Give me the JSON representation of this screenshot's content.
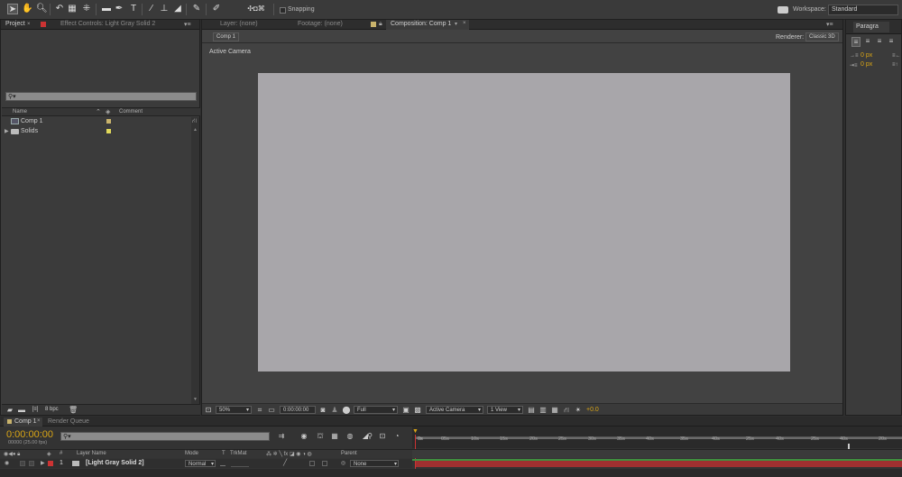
{
  "toolbar": {
    "snapping_label": "Snapping",
    "workspace_label": "Workspace:",
    "workspace_value": "Standard"
  },
  "project_panel": {
    "tab_project": "Project",
    "tab_effect_controls": "Effect Controls: Light Gray Solid 2",
    "search_placeholder": "",
    "col_name": "Name",
    "col_comment": "Comment",
    "items": [
      {
        "name": "Comp 1",
        "label_color": "#c9b36c"
      },
      {
        "name": "Solids",
        "label_color": "#e0d85a"
      }
    ],
    "bpc_label": "8 bpc"
  },
  "viewer": {
    "tab_layer": "Layer: (none)",
    "tab_footage": "Footage: (none)",
    "tab_composition": "Composition: Comp 1",
    "comp_button": "Comp 1",
    "renderer_label": "Renderer:",
    "renderer_value": "Classic 3D",
    "active_camera_label": "Active Camera",
    "canvas_color": "#a8a6aa",
    "footer": {
      "zoom": "50%",
      "timecode": "0:00:00:00",
      "resolution": "Full",
      "camera": "Active Camera",
      "views": "1 View",
      "exposure": "+0.0"
    }
  },
  "paragraph_panel": {
    "tab": "Paragra",
    "indent_values": [
      "0 px",
      "0 px",
      "0 px"
    ]
  },
  "timeline": {
    "tab_comp": "Comp 1",
    "tab_render_queue": "Render Queue",
    "timecode": "0:00:00:00",
    "frame_info": "00000 (25.00 fps)",
    "col_layer_name": "Layer Name",
    "col_mode": "Mode",
    "col_t": "T",
    "col_trkmat": "TrkMat",
    "col_parent": "Parent",
    "col_hash": "#",
    "ruler_ticks": [
      "0s",
      "05s",
      "10s",
      "15s",
      "20s",
      "25s",
      "30s",
      "35s",
      "40s",
      "45s",
      "50s",
      "55s",
      "01:00s",
      "05s",
      "10s",
      "15s",
      "20s"
    ],
    "ruler_ticks_visible": [
      "0s",
      "05s",
      "10s",
      "15s",
      "20s",
      "25s",
      "30s",
      "35s",
      "40s",
      "35s",
      "40s",
      "25s",
      "40s",
      "25s",
      "40s",
      "20s"
    ],
    "layers": [
      {
        "index": "1",
        "name": "[Light Gray Solid 2]",
        "mode": "Normal",
        "parent": "None",
        "label_color": "#cc3333"
      }
    ],
    "accent": "#d9a516"
  }
}
